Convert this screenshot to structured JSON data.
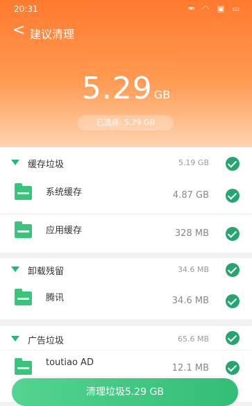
{
  "status_bar": {
    "time": "20:31",
    "icons": "⚮ ◠ ▣ ▭"
  },
  "header": {
    "back": "<",
    "title": "建议清理",
    "total_value": "5.29",
    "total_unit": "GB",
    "selected_label": "已选择: 5.29 GB"
  },
  "groups": [
    {
      "name": "缓存垃圾",
      "size": "5.19 GB",
      "checked": true,
      "items": [
        {
          "name": "系统缓存",
          "size": "4.87 GB",
          "checked": true
        },
        {
          "name": "应用缓存",
          "size": "328 MB",
          "checked": true
        }
      ]
    },
    {
      "name": "卸载残留",
      "size": "34.6 MB",
      "checked": true,
      "items": [
        {
          "name": "腾讯",
          "size": "34.6 MB",
          "checked": true
        }
      ]
    },
    {
      "name": "广告垃圾",
      "size": "65.6 MB",
      "checked": true,
      "items": [
        {
          "name": "toutiao AD",
          "size": "12.1 MB",
          "checked": true
        }
      ]
    }
  ],
  "action_button": "清理垃圾5.29 GB",
  "colors": {
    "header_top": "#ff7a2e",
    "accent_green": "#25a56f",
    "button_green": "#3fc57e"
  }
}
